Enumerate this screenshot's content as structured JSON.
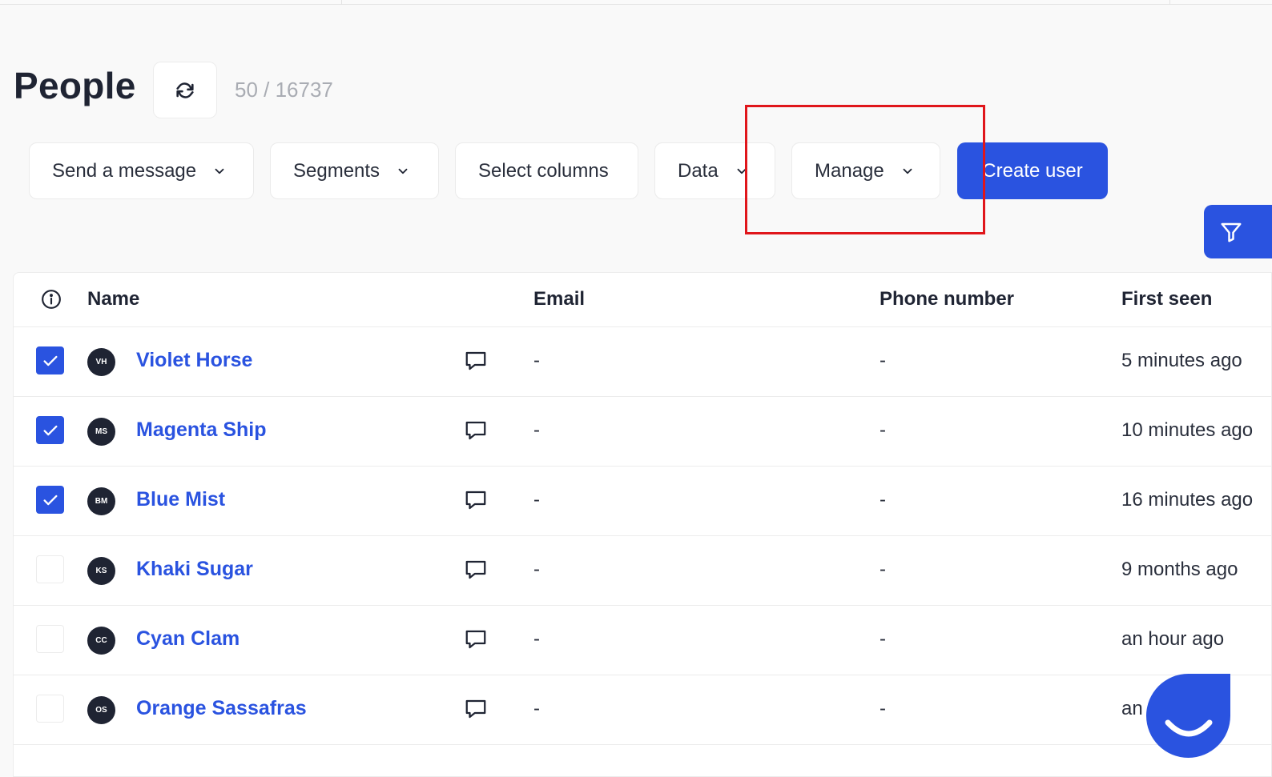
{
  "header": {
    "title": "People",
    "count": "50 / 16737"
  },
  "toolbar": {
    "send_label": "Send a message",
    "segments_label": "Segments",
    "columns_label": "Select columns",
    "data_label": "Data",
    "manage_label": "Manage",
    "create_label": "Create user"
  },
  "table": {
    "columns": [
      "Name",
      "Email",
      "Phone number",
      "First seen"
    ],
    "rows": [
      {
        "checked": true,
        "initials": "VH",
        "name": "Violet Horse",
        "email": "-",
        "phone": "-",
        "first_seen": "5 minutes ago"
      },
      {
        "checked": true,
        "initials": "MS",
        "name": "Magenta Ship",
        "email": "-",
        "phone": "-",
        "first_seen": "10 minutes ago"
      },
      {
        "checked": true,
        "initials": "BM",
        "name": "Blue Mist",
        "email": "-",
        "phone": "-",
        "first_seen": "16 minutes ago"
      },
      {
        "checked": false,
        "initials": "KS",
        "name": "Khaki Sugar",
        "email": "-",
        "phone": "-",
        "first_seen": "9 months ago"
      },
      {
        "checked": false,
        "initials": "CC",
        "name": "Cyan Clam",
        "email": "-",
        "phone": "-",
        "first_seen": "an hour ago"
      },
      {
        "checked": false,
        "initials": "OS",
        "name": "Orange Sassafras",
        "email": "-",
        "phone": "-",
        "first_seen": "an"
      }
    ]
  },
  "colors": {
    "accent": "#2a53e0",
    "highlight": "#e0161b"
  },
  "icons": {
    "refresh": "refresh-icon",
    "chevron": "chevron-down-icon",
    "filter": "filter-icon",
    "info": "info-icon",
    "message": "message-icon",
    "check": "check-icon",
    "chat": "chat-launcher-icon"
  }
}
